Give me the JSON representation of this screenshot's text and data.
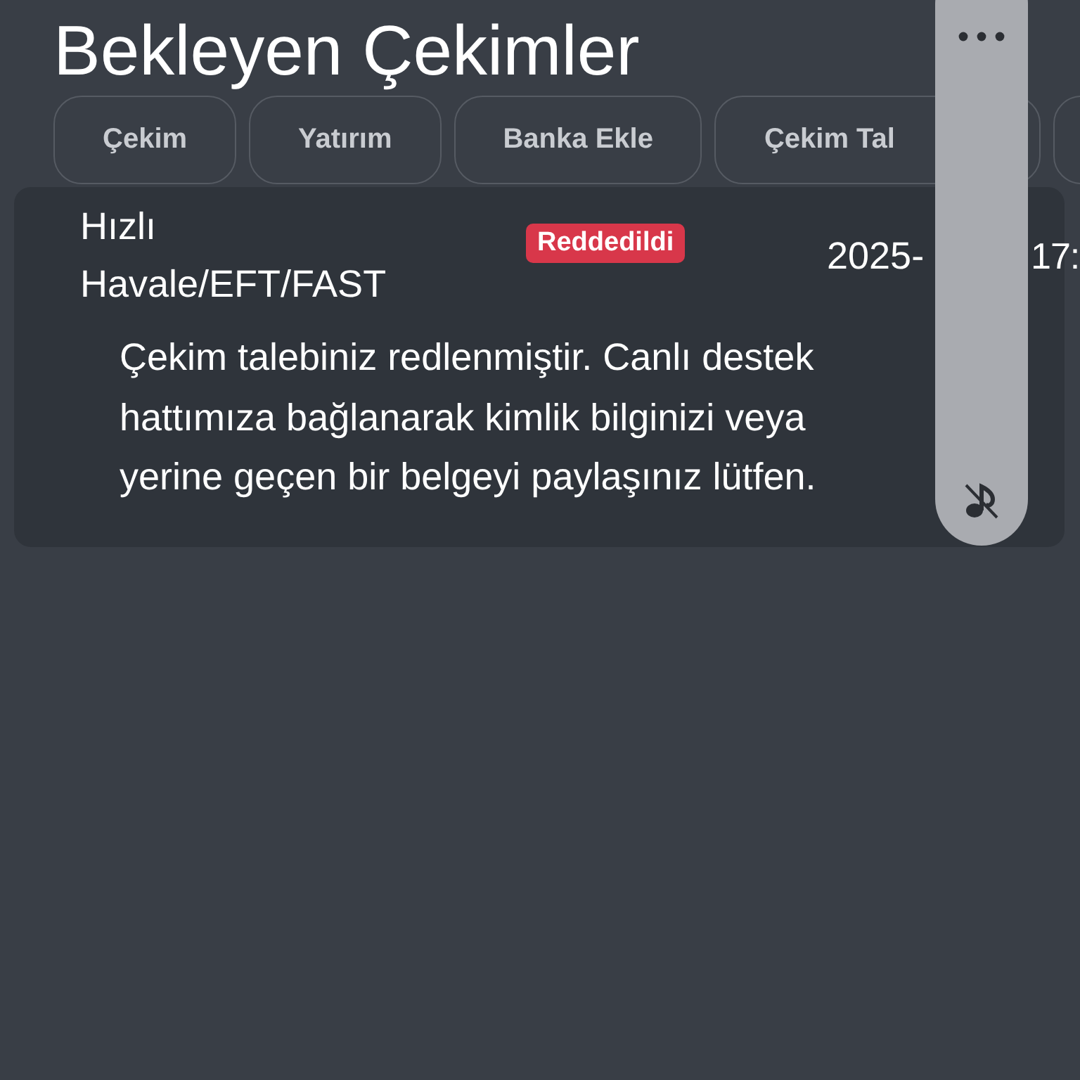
{
  "page": {
    "title": "Bekleyen Çekimler"
  },
  "tabs": [
    {
      "label": "Çekim",
      "selected": false
    },
    {
      "label": "Yatırım",
      "selected": false
    },
    {
      "label": "Banka Ekle",
      "selected": false
    },
    {
      "label": "Çekim Tal",
      "selected": false
    },
    {
      "selected": false
    }
  ],
  "withdrawals": [
    {
      "method_line_1": "Hızlı",
      "method_line_2": "Havale/EFT/FAST",
      "status": "Reddedildi",
      "date_visible_start": "2025-",
      "date_visible_end": "17:",
      "message": "Çekim talebiniz redlenmiştir. Canlı destek hattımıza bağlanarak kimlik bilginizi veya yerine geçen bir belgeyi paylaşınız lütfen."
    }
  ],
  "floating_panel": {
    "sound_muted": true
  }
}
